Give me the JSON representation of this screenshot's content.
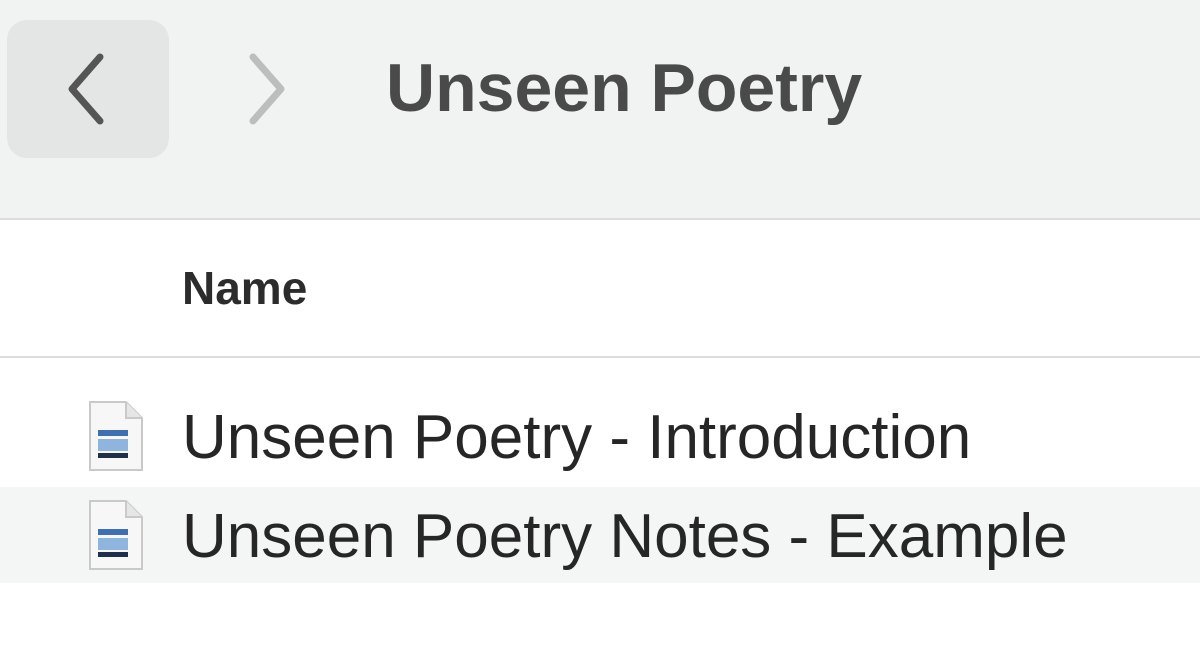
{
  "toolbar": {
    "back_icon": "chevron-left-icon",
    "forward_icon": "chevron-right-icon",
    "title": "Unseen Poetry"
  },
  "list": {
    "column_name_label": "Name",
    "items": [
      {
        "name": "Unseen Poetry - Introduction",
        "icon": "document-icon"
      },
      {
        "name": "Unseen Poetry Notes - Example",
        "icon": "document-icon"
      }
    ]
  },
  "colors": {
    "toolbar_bg": "#f1f3f2",
    "selected_row_bg": "#f4f5f5",
    "text": "#262626"
  }
}
